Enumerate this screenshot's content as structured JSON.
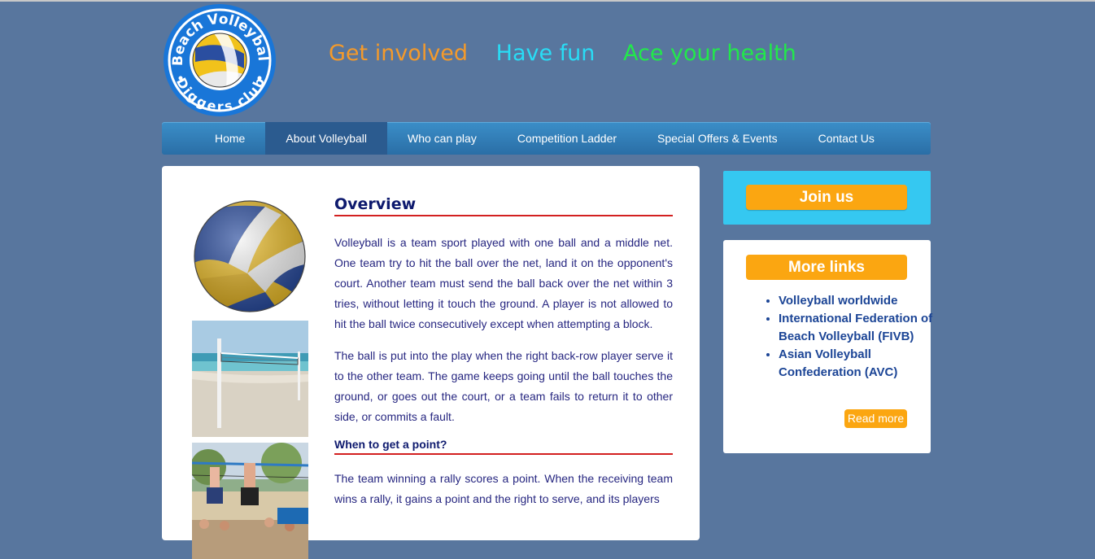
{
  "logo": {
    "text_top": "Beach Volleyball",
    "text_bottom": "Diggers club"
  },
  "taglines": [
    "Get involved",
    "Have fun",
    "Ace your health"
  ],
  "nav": {
    "items": [
      "Home",
      "About Volleyball",
      "Who can play",
      "Competition Ladder",
      "Special Offers & Events",
      "Contact Us"
    ],
    "active": "About Volleyball"
  },
  "main": {
    "title": "Overview",
    "paragraph1": "Volleyball is a team sport played with one ball and a middle net. One team try to hit the ball over the net, land it on the opponent's court. Another team must send the ball back over the net within 3 tries, without letting it touch the ground. A player is not allowed to hit the ball twice consecutively except when attempting a block.",
    "paragraph2": "The ball is put into the play when the right back-row player serve it to the other team. The game keeps going until the ball touches the ground, or goes out the court, or a team fails to return it to other side, or commits a fault.",
    "subheading": "When to get a point?",
    "paragraph3": "The team winning a rally scores a point. When the receiving team wins a rally, it gains a point and the right to serve, and its players"
  },
  "sidebar": {
    "join_label": "Join us",
    "links_title": "More links",
    "links": [
      "Volleyball worldwide",
      "International Federation of Beach Volleyball (FIVB)",
      "Asian Volleyball Confederation (AVC)"
    ],
    "read_more": "Read more"
  },
  "colors": {
    "background": "#58769e",
    "tagline1": "#f49a2b",
    "tagline2": "#29dcf5",
    "tagline3": "#22e84b",
    "accent_orange": "#fba611",
    "join_box": "#35c8f1",
    "heading_rule": "#d32020"
  }
}
